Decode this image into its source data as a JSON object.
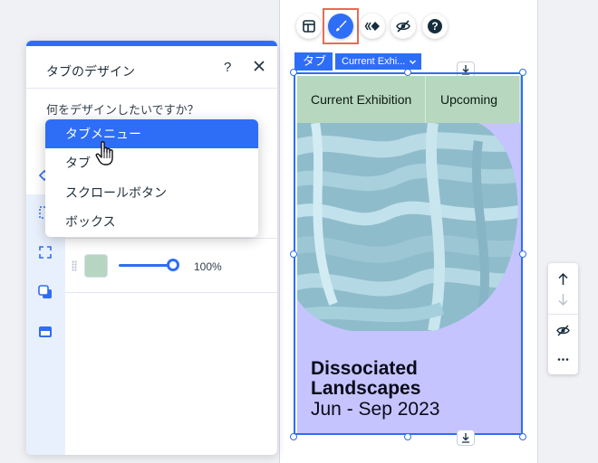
{
  "panel": {
    "title": "タブのデザイン",
    "help": "?",
    "question": "何をデザインしたいですか？",
    "opacity_value": "100%",
    "opacity_level": 100,
    "fill_color": "#b6d6c2"
  },
  "dropdown": {
    "items": [
      "タブメニュー",
      "タブ",
      "スクロールボタン",
      "ボックス"
    ],
    "selected": "タブメニュー"
  },
  "toolbar": {
    "icons": [
      "layout-icon",
      "paint-brush-icon",
      "animation-icon",
      "hidden-eye-icon",
      "help-icon"
    ]
  },
  "element": {
    "tag_label": "タブ",
    "selected_tab": "Current Exhi...",
    "tabs": [
      "Current Exhibition",
      "Upcoming"
    ],
    "hero_title_line1": "Dissociated",
    "hero_title_line2": "Landscapes",
    "hero_date": "Jun - Sep 2023"
  },
  "colors": {
    "accent": "#2e6df6",
    "tabs_background": "#b7d8bf",
    "hero_background": "#c5c4ff",
    "highlight_frame": "#e86b57"
  }
}
